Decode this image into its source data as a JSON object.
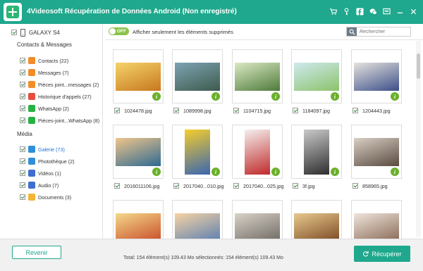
{
  "app": {
    "title": "4Videosoft Récupération de Données Android (Non enregistré)"
  },
  "titlebar_icons": [
    "cart-icon",
    "key-icon",
    "facebook-icon",
    "chat-icon",
    "feedback-icon",
    "minimize-icon",
    "close-icon"
  ],
  "sidebar": {
    "device": "GALAXY S4",
    "section_contacts": "Contacts & Messages",
    "section_media": "Média",
    "contacts_items": [
      {
        "label": "Contacts (22)",
        "icon": "contacts-icon",
        "color": "#f28c28"
      },
      {
        "label": "Messages (7)",
        "icon": "messages-icon",
        "color": "#f28c28"
      },
      {
        "label": "Pièces joint...messages (2)",
        "icon": "message-attachments-icon",
        "color": "#f28c28"
      },
      {
        "label": "Historique d'appels (27)",
        "icon": "call-history-icon",
        "color": "#e84c3d"
      },
      {
        "label": "WhatsApp (2)",
        "icon": "whatsapp-icon",
        "color": "#25b245"
      },
      {
        "label": "Pièces-joint...WhatsApp (8)",
        "icon": "whatsapp-attachments-icon",
        "color": "#25b245"
      }
    ],
    "media_items": [
      {
        "label": "Galerie (73)",
        "icon": "gallery-icon",
        "color": "#2f8fd8",
        "active": true
      },
      {
        "label": "Photothèque (2)",
        "icon": "photo-library-icon",
        "color": "#2f8fd8"
      },
      {
        "label": "Vidéos (1)",
        "icon": "videos-icon",
        "color": "#3d6fd0"
      },
      {
        "label": "Audio (7)",
        "icon": "audio-icon",
        "color": "#3d6fd0"
      },
      {
        "label": "Documents (3)",
        "icon": "documents-icon",
        "color": "#f2b535"
      }
    ]
  },
  "filter": {
    "toggle_state": "OFF",
    "label": "Afficher seulement les éléments supprimés",
    "search_placeholder": "Rechercher"
  },
  "gallery": {
    "files": [
      {
        "name": "1024478.jpg",
        "icon": "sunset-photo",
        "colors": [
          "#f5d36b",
          "#c7781f"
        ]
      },
      {
        "name": "1089998.jpg",
        "icon": "landscape-photo",
        "colors": [
          "#7da4b3",
          "#3e5a4d"
        ]
      },
      {
        "name": "1104715.jpg",
        "icon": "flowers-photo",
        "colors": [
          "#dbe9c4",
          "#4e7a3a"
        ]
      },
      {
        "name": "1184097.jpg",
        "icon": "field-photo",
        "colors": [
          "#cfe9ef",
          "#8cc36b"
        ]
      },
      {
        "name": "1204443.jpg",
        "icon": "berries-photo",
        "colors": [
          "#e5e3dd",
          "#3d4f8a"
        ]
      },
      {
        "name": "2016011106.jpg",
        "icon": "sea-photo",
        "colors": [
          "#f0c58b",
          "#2f6a91"
        ]
      },
      {
        "name": "2017040...010.jpg",
        "icon": "minion-photo",
        "colors": [
          "#f5cd2c",
          "#3a66b0"
        ]
      },
      {
        "name": "2017040...025.jpg",
        "icon": "gift-photo",
        "colors": [
          "#f4f0ee",
          "#c02a2a"
        ]
      },
      {
        "name": "3f.jpg",
        "icon": "portrait-photo",
        "colors": [
          "#c9c9c9",
          "#2e2e2e"
        ]
      },
      {
        "name": "858965.jpg",
        "icon": "woman-photo",
        "colors": [
          "#d9cfc4",
          "#5a4a40"
        ]
      },
      {
        "name": "",
        "icon": "flower-photo",
        "colors": [
          "#f3d98a",
          "#c94d2a"
        ]
      },
      {
        "name": "",
        "icon": "beach-photo",
        "colors": [
          "#f6d3a3",
          "#5b7fb2"
        ]
      },
      {
        "name": "",
        "icon": "street-photo",
        "colors": [
          "#d8d2c8",
          "#6f6a63"
        ]
      },
      {
        "name": "",
        "icon": "horse-photo",
        "colors": [
          "#e8c98e",
          "#7b4a23"
        ]
      },
      {
        "name": "",
        "icon": "girl-photo",
        "colors": [
          "#efe4dc",
          "#8a6a55"
        ]
      }
    ]
  },
  "footer": {
    "back_label": "Revenir",
    "total_text": "Total: 154 élément(s) 109.43 Mo    sélectionnés: 154 élément(s) 109.43 Mo",
    "recover_label": "Récupérer"
  },
  "colors": {
    "accent": "#1fa88d",
    "info_badge": "#6bb02b",
    "active_item": "#2a6fd6"
  }
}
